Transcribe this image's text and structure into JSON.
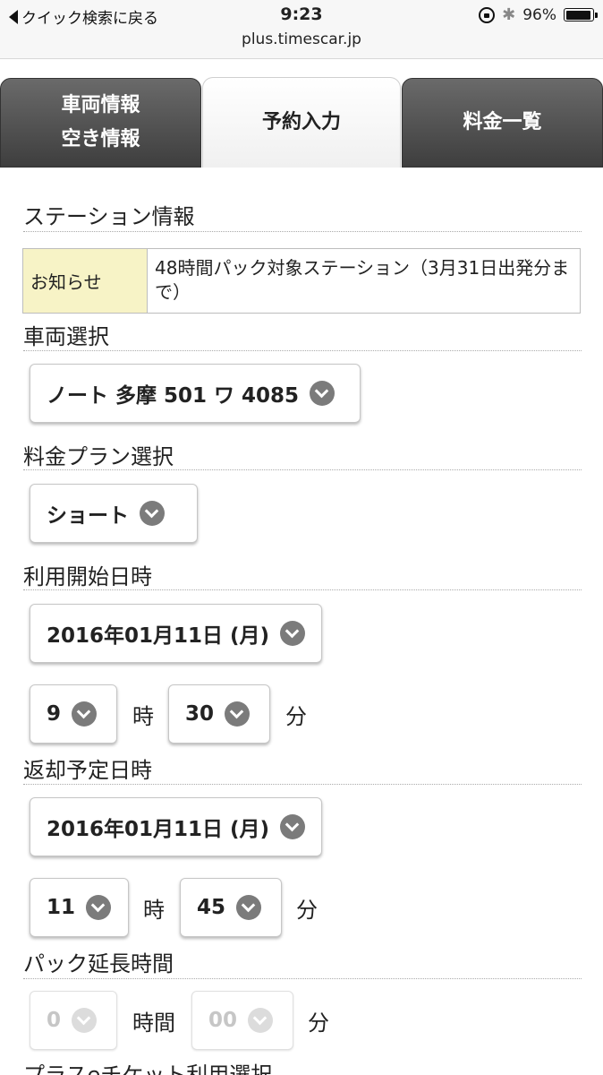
{
  "status_bar": {
    "back_label": "クイック検索に戻る",
    "time": "9:23",
    "battery": "96%",
    "battery_level": 0.96,
    "url": "plus.timescar.jp"
  },
  "tabs": [
    {
      "label_line1": "車両情報",
      "label_line2": "空き情報",
      "active": false
    },
    {
      "label": "予約入力",
      "active": true
    },
    {
      "label": "料金一覧",
      "active": false
    }
  ],
  "station_info": {
    "title": "ステーション情報",
    "notice_label": "お知らせ",
    "notice_text": "48時間パック対象ステーション（3月31日出発分まで）"
  },
  "vehicle": {
    "title": "車両選択",
    "selected": "ノート 多摩 501 ワ 4085"
  },
  "plan": {
    "title": "料金プラン選択",
    "selected": "ショート"
  },
  "start": {
    "title": "利用開始日時",
    "date": "2016年01月11日 (月)",
    "hour": "9",
    "hour_unit": "時",
    "minute": "30",
    "minute_unit": "分"
  },
  "return": {
    "title": "返却予定日時",
    "date": "2016年01月11日 (月)",
    "hour": "11",
    "hour_unit": "時",
    "minute": "45",
    "minute_unit": "分"
  },
  "pack_extension": {
    "title": "パック延長時間",
    "hours": "0",
    "hours_unit": "時間",
    "minutes": "00",
    "minutes_unit": "分"
  },
  "ticket": {
    "title": "プラスeチケット利用選択"
  }
}
